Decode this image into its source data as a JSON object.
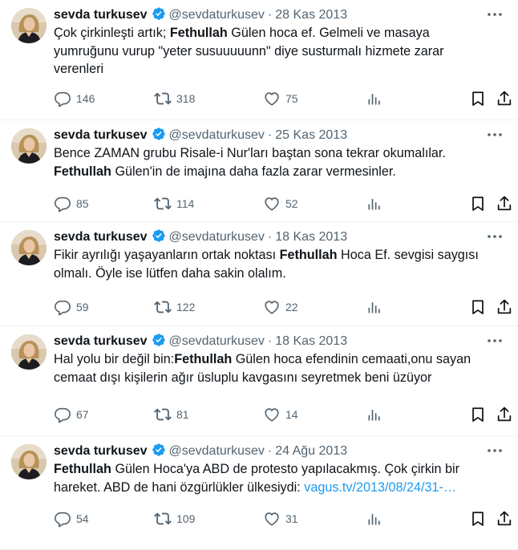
{
  "author": {
    "name": "sevda turkusev",
    "handle": "@sevdaturkusev",
    "separator": "·"
  },
  "colors": {
    "verified": "#1d9bf0",
    "link": "#1d9bf0",
    "secondary_text": "#536471",
    "divider": "#eff3f4"
  },
  "icons": [
    "verified-badge-icon",
    "more-icon",
    "reply-icon",
    "retweet-icon",
    "like-icon",
    "views-icon",
    "bookmark-icon",
    "share-icon"
  ],
  "tweets": [
    {
      "date": "28 Kas 2013",
      "segments": [
        {
          "text": "Çok çirkinleşti artık; ",
          "style": "normal"
        },
        {
          "text": "Fethullah",
          "style": "bold"
        },
        {
          "text": " Gülen hoca ef. Gelmeli ve masaya yumruğunu vurup \"yeter susuuuuunn\" diye susturmalı hizmete zarar verenleri",
          "style": "normal"
        }
      ],
      "replies": "146",
      "retweets": "318",
      "likes": "75"
    },
    {
      "date": "25 Kas 2013",
      "segments": [
        {
          "text": "Bence ZAMAN grubu Risale-i Nur'ları baştan sona tekrar okumalılar. ",
          "style": "normal"
        },
        {
          "text": "Fethullah",
          "style": "bold"
        },
        {
          "text": " Gülen'in de imajına daha fazla zarar vermesinler.",
          "style": "normal"
        }
      ],
      "replies": "85",
      "retweets": "114",
      "likes": "52"
    },
    {
      "date": "18 Kas 2013",
      "segments": [
        {
          "text": "Fikir ayrılığı yaşayanların ortak noktası ",
          "style": "normal"
        },
        {
          "text": "Fethullah",
          "style": "bold"
        },
        {
          "text": " Hoca Ef. sevgisi saygısı olmalı. Öyle ise lütfen daha sakin olalım.",
          "style": "normal"
        }
      ],
      "replies": "59",
      "retweets": "122",
      "likes": "22"
    },
    {
      "date": "18 Kas 2013",
      "segments": [
        {
          "text": "Hal yolu bir değil bin:",
          "style": "normal"
        },
        {
          "text": "Fethullah",
          "style": "bold"
        },
        {
          "text": " Gülen hoca efendinin cemaati,onu sayan cemaat dışı kişilerin ağır üsluplu  kavgasını seyretmek beni üzüyor",
          "style": "normal"
        }
      ],
      "replies": "67",
      "retweets": "81",
      "likes": "14"
    },
    {
      "date": "24 Ağu 2013",
      "segments": [
        {
          "text": "Fethullah",
          "style": "bold"
        },
        {
          "text": " Gülen Hoca'ya ABD de protesto yapılacakmış. Çok çirkin bir hareket. ABD de hani özgürlükler ülkesiydi: ",
          "style": "normal"
        },
        {
          "text": "vagus.tv/2013/08/24/31-…",
          "style": "link"
        }
      ],
      "replies": "54",
      "retweets": "109",
      "likes": "31"
    }
  ]
}
